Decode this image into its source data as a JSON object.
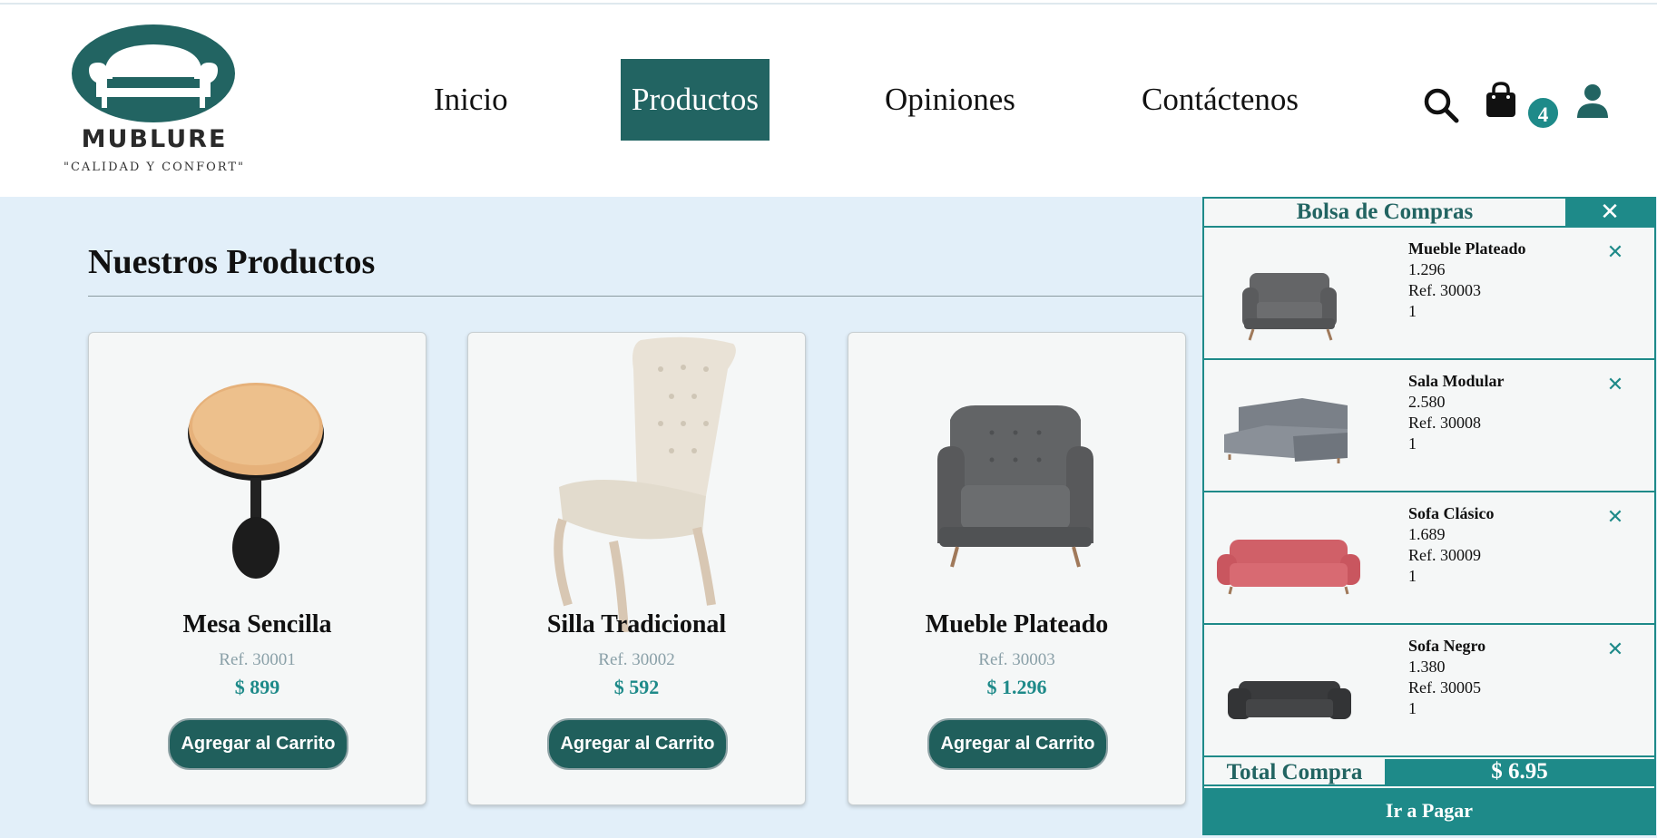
{
  "brand": {
    "name": "MUBLURE",
    "tagline": "\"CALIDAD Y CONFORT\""
  },
  "nav": {
    "items": [
      {
        "label": "Inicio",
        "active": false
      },
      {
        "label": "Productos",
        "active": true
      },
      {
        "label": "Opiniones",
        "active": false
      },
      {
        "label": "Contáctenos",
        "active": false
      }
    ]
  },
  "header_icons": {
    "search": "search-icon",
    "cart": "shopping-bag-icon",
    "cart_count": "4",
    "user": "user-icon"
  },
  "colors": {
    "primary_dark": "#226462",
    "primary": "#1e8a89",
    "background": "#e2eff9"
  },
  "main": {
    "title": "Nuestros Productos",
    "products": [
      {
        "name": "Mesa Sencilla",
        "ref": "Ref. 30001",
        "price": "$ 899",
        "button": "Agregar al Carrito"
      },
      {
        "name": "Silla Tradicional",
        "ref": "Ref. 30002",
        "price": "$ 592",
        "button": "Agregar al Carrito"
      },
      {
        "name": "Mueble Plateado",
        "ref": "Ref. 30003",
        "price": "$ 1.296",
        "button": "Agregar al Carrito"
      }
    ]
  },
  "cart": {
    "title": "Bolsa de Compras",
    "close": "✕",
    "items": [
      {
        "name": "Mueble Plateado",
        "price": "1.296",
        "ref": "Ref. 30003",
        "qty": "1",
        "remove": "✕"
      },
      {
        "name": "Sala Modular",
        "price": "2.580",
        "ref": "Ref. 30008",
        "qty": "1",
        "remove": "✕"
      },
      {
        "name": "Sofa Clásico",
        "price": "1.689",
        "ref": "Ref. 30009",
        "qty": "1",
        "remove": "✕"
      },
      {
        "name": "Sofa Negro",
        "price": "1.380",
        "ref": "Ref. 30005",
        "qty": "1",
        "remove": "✕"
      }
    ],
    "total_label": "Total Compra",
    "total_value": "$ 6.95",
    "pay_button": "Ir a Pagar"
  }
}
